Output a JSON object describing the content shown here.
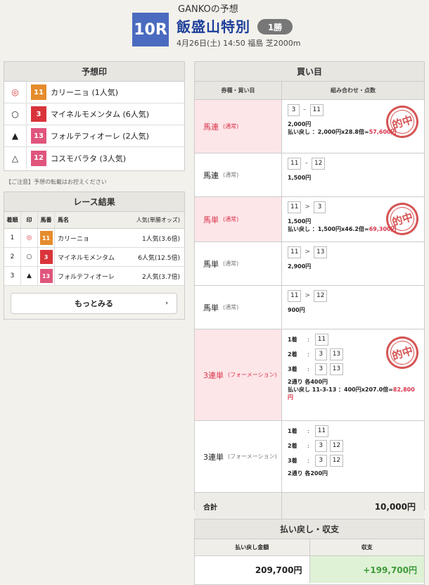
{
  "header": {
    "owner": "GANKOの予想",
    "race_number": "10R",
    "race_name": "飯盛山特別",
    "race_class": "1勝",
    "race_info": "4月26日(土) 14:50 福島 芝2000m"
  },
  "prediction": {
    "title": "予想印",
    "items": [
      {
        "mark": "◎",
        "number": "11",
        "name": "カリーニョ (1人気)",
        "color": "#e58c2d"
      },
      {
        "mark": "○",
        "number": "3",
        "name": "マイネルモメンタム (6人気)",
        "color": "#d9343a"
      },
      {
        "mark": "▲",
        "number": "13",
        "name": "フォルテフィオーレ (2人気)",
        "color": "#e0557c"
      },
      {
        "mark": "△",
        "number": "12",
        "name": "コスモバラタ (3人気)",
        "color": "#e0557c"
      }
    ],
    "note": "【ご注意】予想の転載はお控えください"
  },
  "results": {
    "title": "レース結果",
    "headers": {
      "rank": "着順",
      "mark": "印",
      "num": "馬番",
      "name": "馬名",
      "pop": "人気(単勝オッズ)"
    },
    "rows": [
      {
        "rank": "1",
        "mark": "◎",
        "number": "11",
        "name": "カリーニョ",
        "pop": "1人気(3.6倍)",
        "color": "#e58c2d"
      },
      {
        "rank": "2",
        "mark": "○",
        "number": "3",
        "name": "マイネルモメンタム",
        "pop": "6人気(12.5倍)",
        "color": "#d9343a"
      },
      {
        "rank": "3",
        "mark": "▲",
        "number": "13",
        "name": "フォルテフィオーレ",
        "pop": "2人気(3.7倍)",
        "color": "#e0557c"
      }
    ],
    "more_label": "もっとみる"
  },
  "bets": {
    "title": "買い目",
    "headers": {
      "type": "券種・買い目",
      "combo": "組み合わせ・点数"
    },
    "stamp_text": "的中",
    "rows": [
      {
        "type": "馬連",
        "sub": "(通常)",
        "hit": true,
        "a": "3",
        "sep": "–",
        "b": "11",
        "amount": "2,000円",
        "payout_pre": "払い戻し ：2,000円x28.8倍=",
        "payout_val": "57,600円"
      },
      {
        "type": "馬連",
        "sub": "(通常)",
        "hit": false,
        "a": "11",
        "sep": "–",
        "b": "12",
        "amount": "1,500円"
      },
      {
        "type": "馬単",
        "sub": "(通常)",
        "hit": true,
        "a": "11",
        "sep": ">",
        "b": "3",
        "amount": "1,500円",
        "payout_pre": "払い戻し ：1,500円x46.2倍=",
        "payout_val": "69,300円"
      },
      {
        "type": "馬単",
        "sub": "(通常)",
        "hit": false,
        "a": "11",
        "sep": ">",
        "b": "13",
        "amount": "2,900円"
      },
      {
        "type": "馬単",
        "sub": "(通常)",
        "hit": false,
        "a": "11",
        "sep": ">",
        "b": "12",
        "amount": "900円"
      }
    ],
    "formation1": {
      "type": "3連単",
      "sub": "(フォーメーション)",
      "first_label": "1着",
      "first": [
        "11"
      ],
      "second_label": "2着",
      "second": [
        "3",
        "13"
      ],
      "third_label": "3着",
      "third": [
        "3",
        "13"
      ],
      "amount": "2通り 各400円",
      "payout_pre": "払い戻し 11-3-13 ：400円x207.0倍=",
      "payout_val": "82,800円"
    },
    "formation2": {
      "type": "3連単",
      "sub": "(フォーメーション)",
      "first_label": "1着",
      "first": [
        "11"
      ],
      "second_label": "2着",
      "second": [
        "3",
        "12"
      ],
      "third_label": "3着",
      "third": [
        "3",
        "12"
      ],
      "amount": "2通り 各200円"
    },
    "total_label": "合計",
    "total_value": "10,000円"
  },
  "summary": {
    "title": "払い戻し・収支",
    "payout_label": "払い戻し金額",
    "profit_label": "収支",
    "payout_value": "209,700円",
    "profit_value": "+199,700円"
  }
}
